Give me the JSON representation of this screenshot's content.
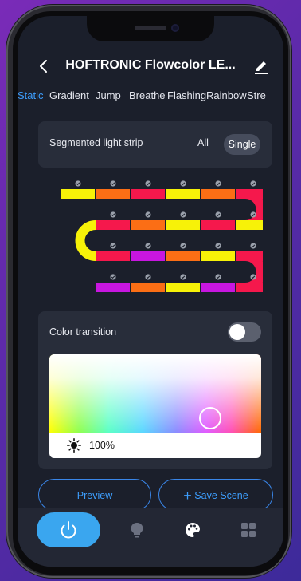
{
  "header": {
    "title": "HOFTRONIC Flowcolor LE..."
  },
  "tabs": [
    {
      "label": "Static",
      "active": true
    },
    {
      "label": "Gradient"
    },
    {
      "label": "Jump"
    },
    {
      "label": "Breathe"
    },
    {
      "label": "Flashing"
    },
    {
      "label": "Rainbow"
    },
    {
      "label": "Stre"
    }
  ],
  "segment": {
    "label": "Segmented light strip",
    "all_label": "All",
    "single_label": "Single",
    "selected": "Single"
  },
  "strip": {
    "row1": [
      "#f7f208",
      "#fb6e15",
      "#f5184c",
      "#f7f208",
      "#fb6e15",
      "#f5184c"
    ],
    "row2": [
      "#f5184c",
      "#fb6e15",
      "#f7f208",
      "#f5184c",
      "#f7f208"
    ],
    "row3": [
      "#f5184c",
      "#c816e0",
      "#fb6e15",
      "#f7f208",
      "#f5184c"
    ],
    "row4": [
      "#c816e0",
      "#fb6e15",
      "#f7f208",
      "#c816e0",
      "#f5184c"
    ]
  },
  "transition": {
    "label": "Color transition",
    "enabled": false
  },
  "brightness": {
    "value": "100%"
  },
  "actions": {
    "preview_label": "Preview",
    "save_label": "Save Scene",
    "save_icon": "+"
  },
  "nav": [
    "power-icon",
    "bulb-icon",
    "palette-icon",
    "grid-icon"
  ],
  "colors": {
    "accent": "#3d9dfc",
    "power_btn": "#3aa6ef",
    "background": "#1b1f2b",
    "card": "#282d3a"
  }
}
